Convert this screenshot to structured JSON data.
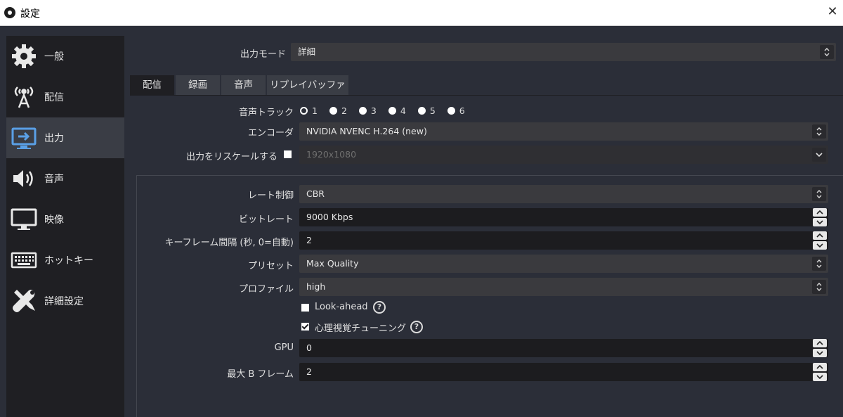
{
  "window": {
    "title": "設定",
    "close_glyph": "✕"
  },
  "sidebar": {
    "items": [
      {
        "label": "一般",
        "icon": "gear-icon"
      },
      {
        "label": "配信",
        "icon": "broadcast-antenna-icon"
      },
      {
        "label": "出力",
        "icon": "output-monitor-icon"
      },
      {
        "label": "音声",
        "icon": "speaker-icon"
      },
      {
        "label": "映像",
        "icon": "display-icon"
      },
      {
        "label": "ホットキー",
        "icon": "keyboard-icon"
      },
      {
        "label": "詳細設定",
        "icon": "tools-icon"
      }
    ],
    "active_index": 2
  },
  "output_mode": {
    "label": "出力モード",
    "value": "詳細"
  },
  "tabs": [
    {
      "label": "配信"
    },
    {
      "label": "録画"
    },
    {
      "label": "音声"
    },
    {
      "label": "リプレイバッファ"
    }
  ],
  "active_tab": 0,
  "audio_track": {
    "label": "音声トラック",
    "options": [
      "1",
      "2",
      "3",
      "4",
      "5",
      "6"
    ],
    "selected": "1"
  },
  "encoder": {
    "label": "エンコーダ",
    "value": "NVIDIA NVENC H.264 (new)"
  },
  "rescale": {
    "label": "出力をリスケールする",
    "checked": false,
    "value": "1920x1080"
  },
  "rate_control": {
    "label": "レート制御",
    "value": "CBR"
  },
  "bitrate": {
    "label": "ビットレート",
    "value": "9000 Kbps"
  },
  "keyframe": {
    "label": "キーフレーム間隔 (秒, 0=自動)",
    "value": "2"
  },
  "preset": {
    "label": "プリセット",
    "value": "Max Quality"
  },
  "profile": {
    "label": "プロファイル",
    "value": "high"
  },
  "lookahead": {
    "label": "Look-ahead",
    "checked": false
  },
  "psycho_visual": {
    "label": "心理視覚チューニング",
    "checked": true
  },
  "gpu": {
    "label": "GPU",
    "value": "0"
  },
  "max_bframes": {
    "label": "最大 B フレーム",
    "value": "2"
  },
  "help_glyph": "?"
}
